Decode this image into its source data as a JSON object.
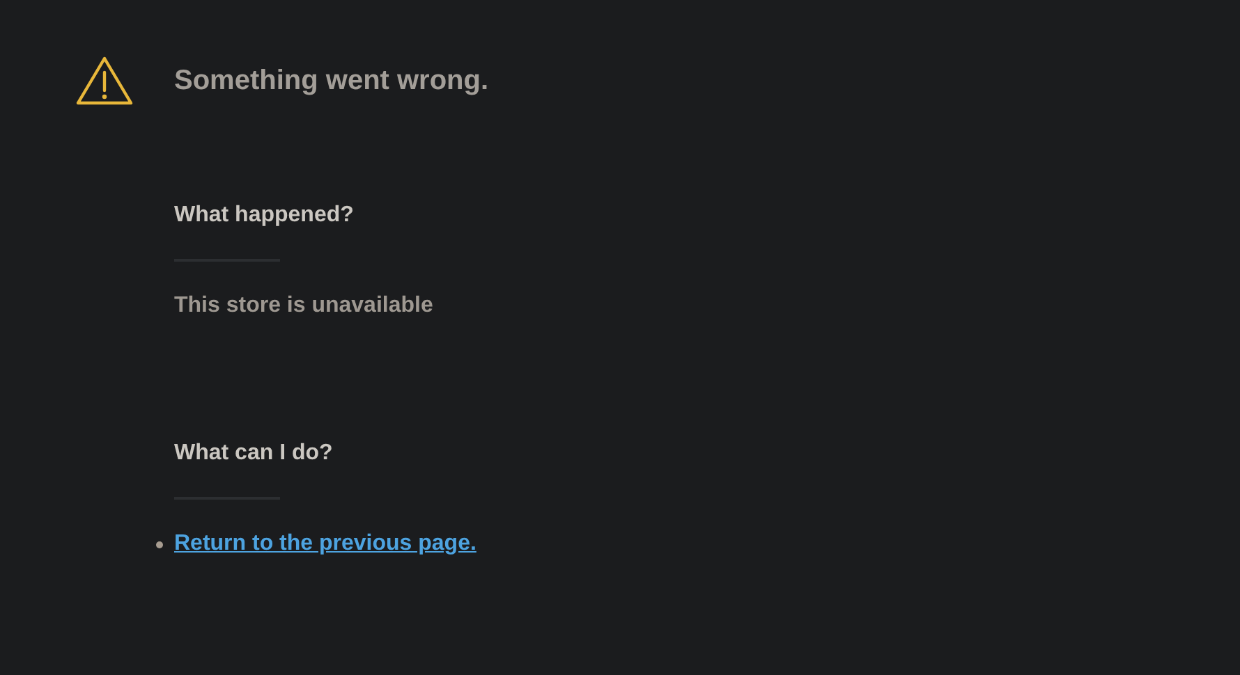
{
  "title": "Something went wrong.",
  "sections": [
    {
      "heading": "What happened?",
      "kind": "text",
      "text": "This store is unavailable"
    },
    {
      "heading": "What can I do?",
      "kind": "links",
      "links": [
        "Return to the previous page."
      ]
    }
  ]
}
